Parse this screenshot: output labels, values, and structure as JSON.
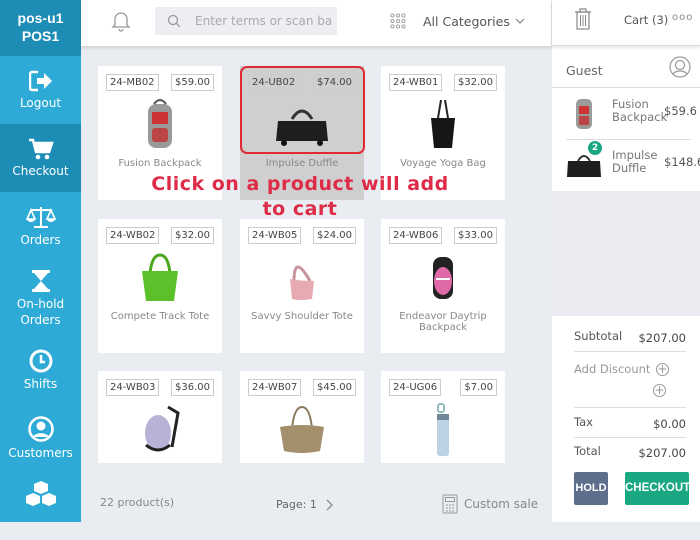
{
  "sidebar": {
    "user": "pos-u1",
    "register": "POS1",
    "items": [
      {
        "label": "Logout",
        "icon": "logout-icon"
      },
      {
        "label": "Checkout",
        "icon": "cart-icon",
        "active": true
      },
      {
        "label": "Orders",
        "icon": "scales-icon"
      },
      {
        "label": "On-hold Orders",
        "icon": "hourglass-icon"
      },
      {
        "label": "Shifts",
        "icon": "clock-icon"
      },
      {
        "label": "Customers",
        "icon": "user-circle-icon"
      },
      {
        "label": "",
        "icon": "cubes-icon"
      }
    ]
  },
  "topbar": {
    "search_placeholder": "Enter terms or scan ba",
    "category": "All Categories"
  },
  "products": [
    {
      "sku": "24-MB02",
      "price": "$59.00",
      "name": "Fusion Backpack"
    },
    {
      "sku": "24-UB02",
      "price": "$74.00",
      "name": "Impulse Duffle",
      "selected": true
    },
    {
      "sku": "24-WB01",
      "price": "$32.00",
      "name": "Voyage Yoga Bag"
    },
    {
      "sku": "24-WB02",
      "price": "$32.00",
      "name": "Compete Track Tote"
    },
    {
      "sku": "24-WB05",
      "price": "$24.00",
      "name": "Savvy Shoulder Tote"
    },
    {
      "sku": "24-WB06",
      "price": "$33.00",
      "name": "Endeavor Daytrip Backpack"
    },
    {
      "sku": "24-WB03",
      "price": "$36.00",
      "name": ""
    },
    {
      "sku": "24-WB07",
      "price": "$45.00",
      "name": ""
    },
    {
      "sku": "24-UG06",
      "price": "$7.00",
      "name": ""
    }
  ],
  "annotation": "Click on a product will add to cart",
  "footer": {
    "count": "22 product(s)",
    "page": "Page: 1",
    "custom_sale": "Custom sale"
  },
  "cart": {
    "title": "Cart (3)",
    "more": "ooo",
    "customer": "Guest",
    "items": [
      {
        "name": "Fusion Backpack",
        "price": "$59.6",
        "qty": ""
      },
      {
        "name": "Impulse Duffle",
        "price": "$148.6",
        "qty": "2"
      }
    ],
    "subtotal_label": "Subtotal",
    "subtotal": "$207.00",
    "discount_label": "Add Discount",
    "tax_label": "Tax",
    "tax": "$0.00",
    "total_label": "Total",
    "total": "$207.00",
    "hold_label": "HOLD",
    "checkout_label": "CHECKOUT"
  },
  "colors": {
    "sidebar": "#2daad6",
    "sidebar_active": "#1e8db6",
    "checkout": "#19a784",
    "hold": "#5e6f8d",
    "annotation": "#de2c48"
  }
}
